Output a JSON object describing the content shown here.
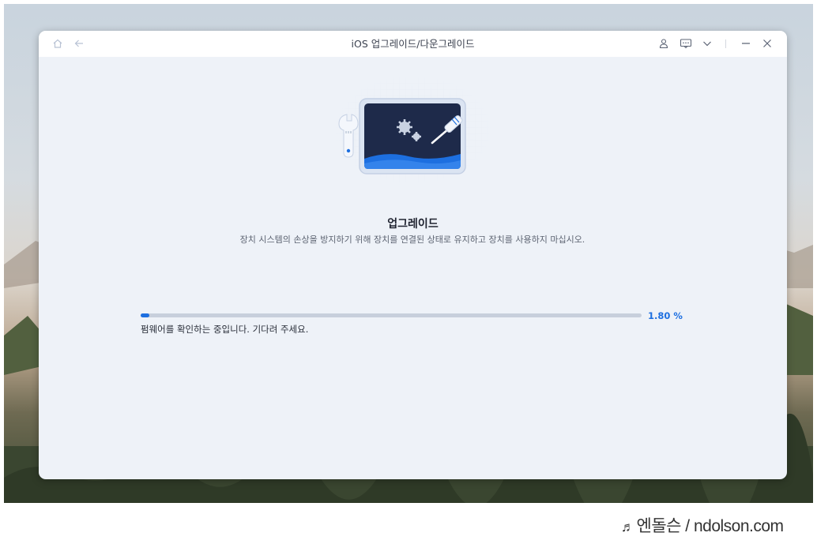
{
  "window": {
    "title": "iOS 업그레이드/다운그레이드"
  },
  "titlebar": {
    "left_icons": [
      "home-icon",
      "back-arrow-icon"
    ],
    "right_icons": [
      "user-icon",
      "feedback-icon",
      "chevron-down-icon",
      "minimize-icon",
      "close-icon"
    ]
  },
  "main": {
    "heading": "업그레이드",
    "description": "장치 시스템의 손상을 방지하기 위해 장치를 연결된 상태로 유지하고 장치를 사용하지 마십시오."
  },
  "progress": {
    "value_percent": 1.8,
    "percent_label": "1.80 %",
    "status": "펌웨어를 확인하는 중입니다. 기다려 주세요."
  },
  "watermark": {
    "text": "엔돌슨 / ndolson.com"
  },
  "colors": {
    "accent": "#1d6fe0",
    "window_bg": "#eef2f8",
    "track": "#c7cfdc",
    "screen": "#1e2a4a"
  }
}
